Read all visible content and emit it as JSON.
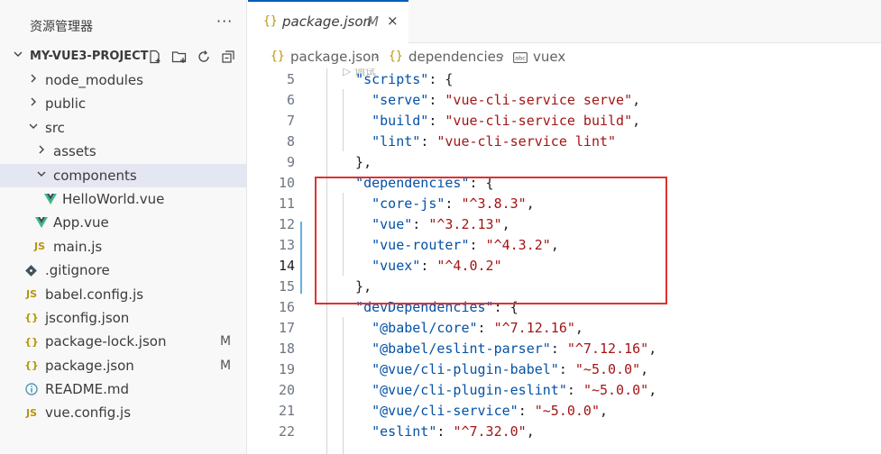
{
  "sidebar": {
    "title": "资源管理器",
    "more": "···",
    "project": "MY-VUE3-PROJECT",
    "items": [
      {
        "label": "node_modules",
        "type": "folder",
        "open": false
      },
      {
        "label": "public",
        "type": "folder",
        "open": false
      },
      {
        "label": "src",
        "type": "folder",
        "open": true
      },
      {
        "label": "assets",
        "type": "folder",
        "open": false
      },
      {
        "label": "components",
        "type": "folder",
        "open": true
      },
      {
        "label": "HelloWorld.vue",
        "type": "vue"
      },
      {
        "label": "App.vue",
        "type": "vue"
      },
      {
        "label": "main.js",
        "type": "js",
        "icon_text": "JS"
      },
      {
        "label": ".gitignore",
        "type": "git"
      },
      {
        "label": "babel.config.js",
        "type": "js",
        "icon_text": "JS"
      },
      {
        "label": "jsconfig.json",
        "type": "json",
        "icon_text": "{}"
      },
      {
        "label": "package-lock.json",
        "type": "json",
        "icon_text": "{}",
        "badge": "M"
      },
      {
        "label": "package.json",
        "type": "json",
        "icon_text": "{}",
        "badge": "M"
      },
      {
        "label": "README.md",
        "type": "info"
      },
      {
        "label": "vue.config.js",
        "type": "js",
        "icon_text": "JS"
      }
    ]
  },
  "tab": {
    "icon": "{}",
    "label": "package.json",
    "modified": "M",
    "close": "×"
  },
  "breadcrumb": {
    "file_icon": "{}",
    "file": "package.json",
    "sep": "›",
    "key_icon": "{}",
    "key": "dependencies",
    "leaf": "vuex"
  },
  "editor": {
    "ghost_text": "▷ 调试",
    "lines": [
      {
        "n": "5",
        "t": [
          [
            "  ",
            "p"
          ],
          [
            "\"scripts\"",
            "k"
          ],
          [
            ": {",
            "p"
          ]
        ]
      },
      {
        "n": "6",
        "t": [
          [
            "    ",
            "p"
          ],
          [
            "\"serve\"",
            "k"
          ],
          [
            ": ",
            "p"
          ],
          [
            "\"vue-cli-service serve\"",
            "s"
          ],
          [
            ",",
            "p"
          ]
        ]
      },
      {
        "n": "7",
        "t": [
          [
            "    ",
            "p"
          ],
          [
            "\"build\"",
            "k"
          ],
          [
            ": ",
            "p"
          ],
          [
            "\"vue-cli-service build\"",
            "s"
          ],
          [
            ",",
            "p"
          ]
        ]
      },
      {
        "n": "8",
        "t": [
          [
            "    ",
            "p"
          ],
          [
            "\"lint\"",
            "k"
          ],
          [
            ": ",
            "p"
          ],
          [
            "\"vue-cli-service lint\"",
            "s"
          ]
        ]
      },
      {
        "n": "9",
        "t": [
          [
            "  },",
            "p"
          ]
        ]
      },
      {
        "n": "10",
        "t": [
          [
            "  ",
            "p"
          ],
          [
            "\"dependencies\"",
            "k"
          ],
          [
            ": {",
            "p"
          ]
        ]
      },
      {
        "n": "11",
        "t": [
          [
            "    ",
            "p"
          ],
          [
            "\"core-js\"",
            "k"
          ],
          [
            ": ",
            "p"
          ],
          [
            "\"^3.8.3\"",
            "s"
          ],
          [
            ",",
            "p"
          ]
        ]
      },
      {
        "n": "12",
        "t": [
          [
            "    ",
            "p"
          ],
          [
            "\"vue\"",
            "k"
          ],
          [
            ": ",
            "p"
          ],
          [
            "\"^3.2.13\"",
            "s"
          ],
          [
            ",",
            "p"
          ]
        ]
      },
      {
        "n": "13",
        "t": [
          [
            "    ",
            "p"
          ],
          [
            "\"vue-router\"",
            "k"
          ],
          [
            ": ",
            "p"
          ],
          [
            "\"^4.3.2\"",
            "s"
          ],
          [
            ",",
            "p"
          ]
        ]
      },
      {
        "n": "14",
        "t": [
          [
            "    ",
            "p"
          ],
          [
            "\"vuex\"",
            "k"
          ],
          [
            ": ",
            "p"
          ],
          [
            "\"^4.0.2\"",
            "s"
          ]
        ],
        "active": true
      },
      {
        "n": "15",
        "t": [
          [
            "  },",
            "p"
          ]
        ]
      },
      {
        "n": "16",
        "t": [
          [
            "  ",
            "p"
          ],
          [
            "\"devDependencies\"",
            "k"
          ],
          [
            ": {",
            "p"
          ]
        ]
      },
      {
        "n": "17",
        "t": [
          [
            "    ",
            "p"
          ],
          [
            "\"@babel/core\"",
            "k"
          ],
          [
            ": ",
            "p"
          ],
          [
            "\"^7.12.16\"",
            "s"
          ],
          [
            ",",
            "p"
          ]
        ]
      },
      {
        "n": "18",
        "t": [
          [
            "    ",
            "p"
          ],
          [
            "\"@babel/eslint-parser\"",
            "k"
          ],
          [
            ": ",
            "p"
          ],
          [
            "\"^7.12.16\"",
            "s"
          ],
          [
            ",",
            "p"
          ]
        ]
      },
      {
        "n": "19",
        "t": [
          [
            "    ",
            "p"
          ],
          [
            "\"@vue/cli-plugin-babel\"",
            "k"
          ],
          [
            ": ",
            "p"
          ],
          [
            "\"~5.0.0\"",
            "s"
          ],
          [
            ",",
            "p"
          ]
        ]
      },
      {
        "n": "20",
        "t": [
          [
            "    ",
            "p"
          ],
          [
            "\"@vue/cli-plugin-eslint\"",
            "k"
          ],
          [
            ": ",
            "p"
          ],
          [
            "\"~5.0.0\"",
            "s"
          ],
          [
            ",",
            "p"
          ]
        ]
      },
      {
        "n": "21",
        "t": [
          [
            "    ",
            "p"
          ],
          [
            "\"@vue/cli-service\"",
            "k"
          ],
          [
            ": ",
            "p"
          ],
          [
            "\"~5.0.0\"",
            "s"
          ],
          [
            ",",
            "p"
          ]
        ]
      },
      {
        "n": "22",
        "t": [
          [
            "    ",
            "p"
          ],
          [
            "\"eslint\"",
            "k"
          ],
          [
            ": ",
            "p"
          ],
          [
            "\"^7.32.0\"",
            "s"
          ],
          [
            ",",
            "p"
          ]
        ]
      }
    ]
  },
  "colors": {
    "accent": "#005fb8",
    "key": "#0451a5",
    "string": "#a31515",
    "highlight": "#e03131",
    "vue": "#41b883",
    "js": "#b7950b"
  }
}
